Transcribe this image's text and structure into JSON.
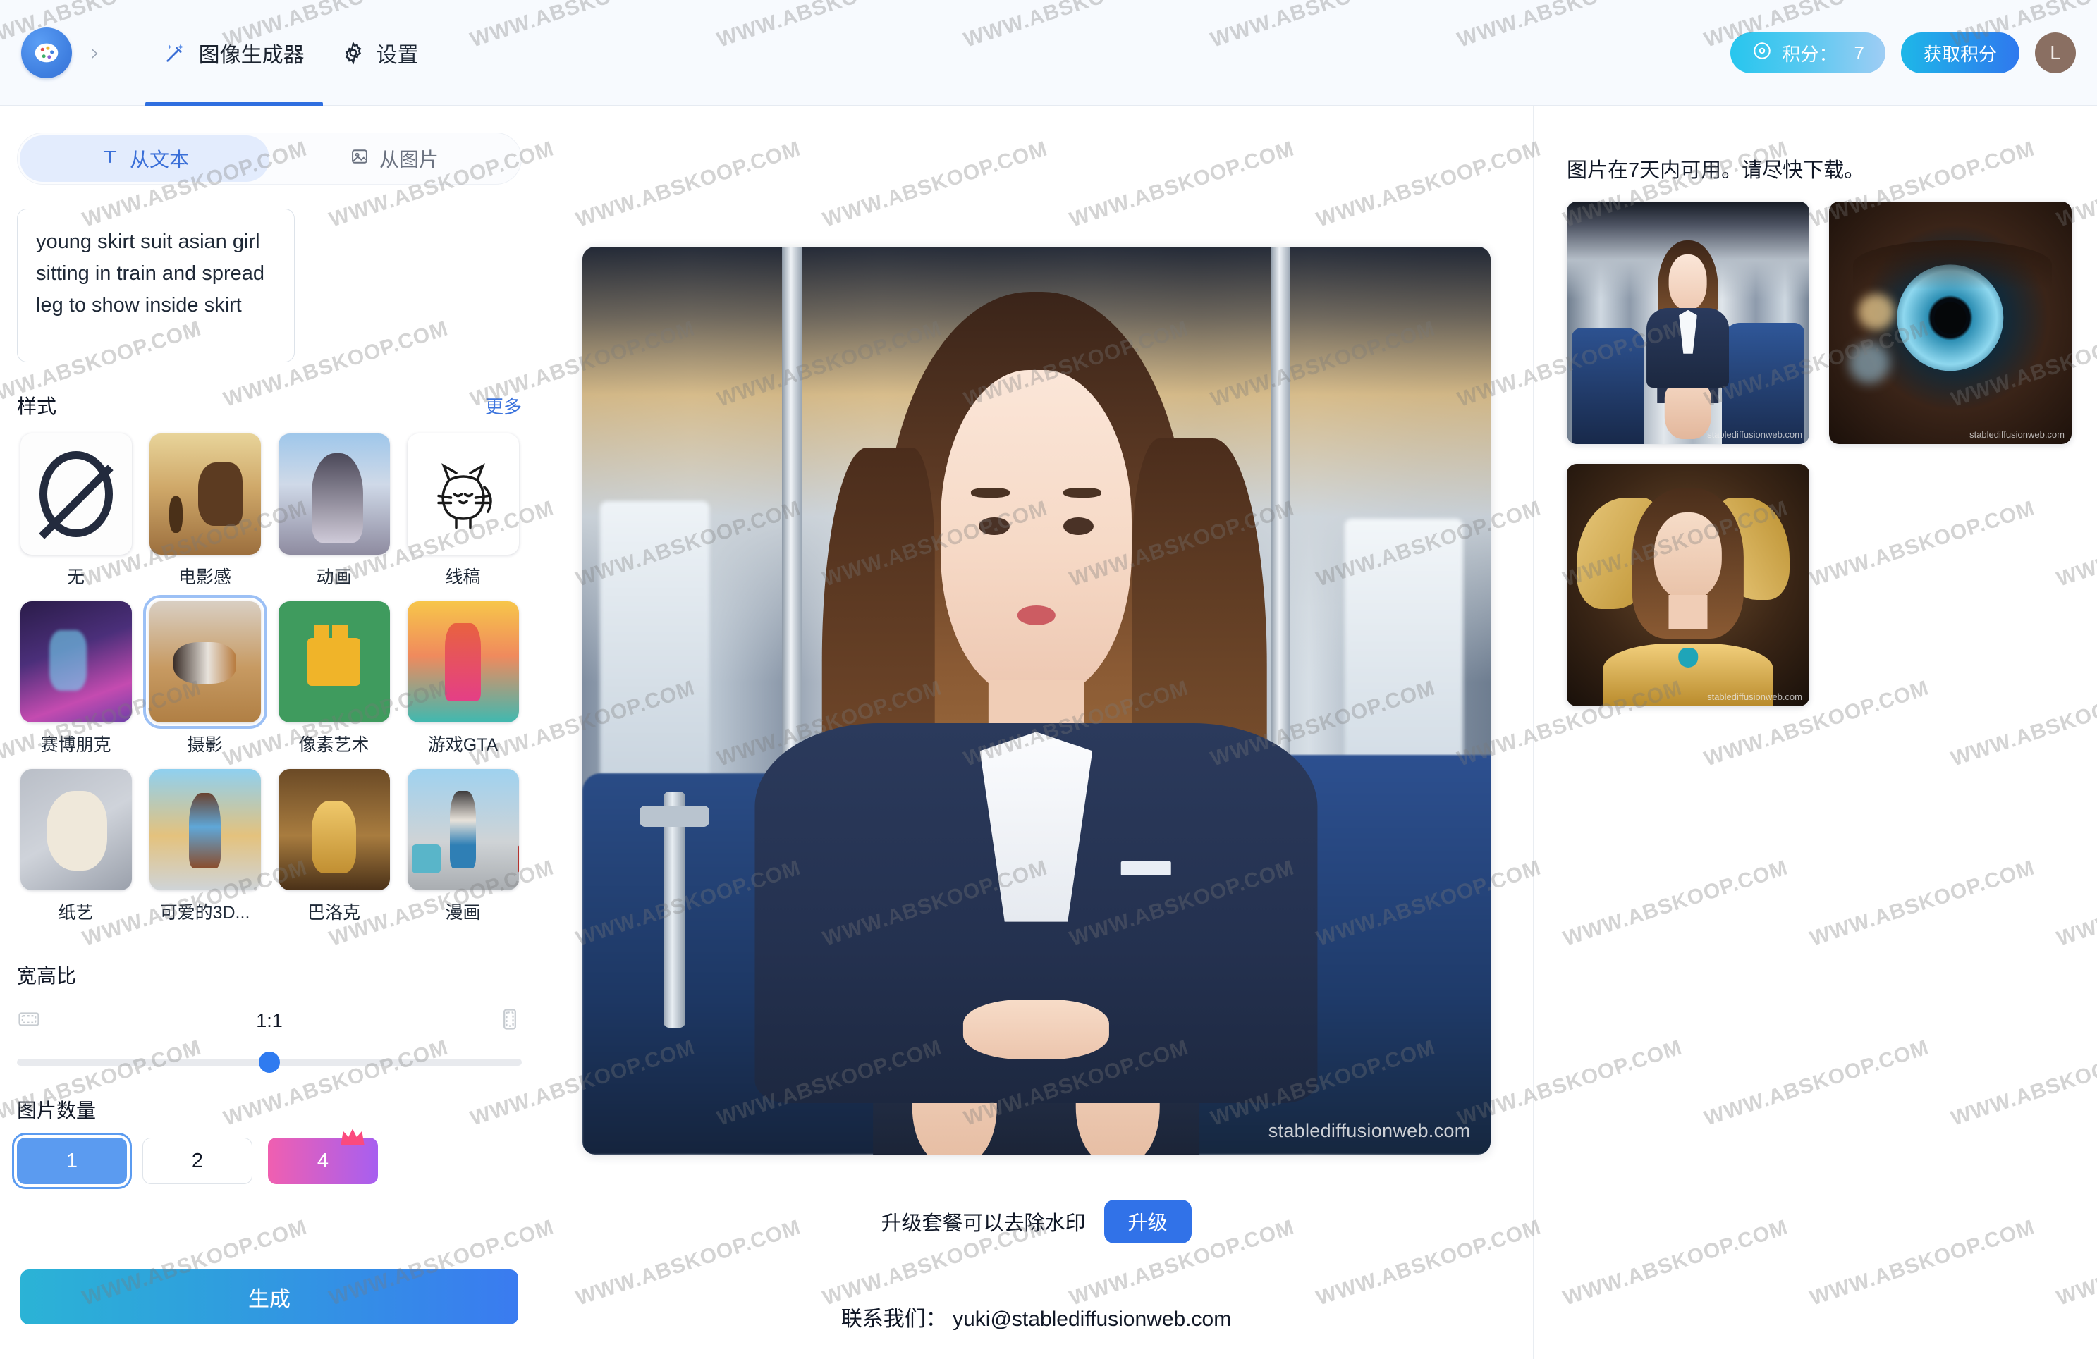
{
  "header": {
    "logo_icon": "palette-brain-logo",
    "chevron_icon": "chevron-right-icon",
    "nav": [
      {
        "label": "图像生成器",
        "icon": "magic-wand-icon",
        "active": true
      },
      {
        "label": "设置",
        "icon": "gear-icon",
        "active": false
      }
    ],
    "credits": {
      "icon": "credit-token-icon",
      "label": "积分：",
      "value": "7"
    },
    "get_credits_label": "获取积分",
    "avatar_initial": "L"
  },
  "left_panel": {
    "source_tabs": [
      {
        "label": "从文本",
        "icon": "text-t-icon",
        "active": true
      },
      {
        "label": "从图片",
        "icon": "image-icon",
        "active": false
      }
    ],
    "prompt": {
      "value": "young skirt suit asian girl sitting in train and spread leg to show inside skirt",
      "placeholder": "young skirt suit asian girl sitting in train and spread leg to show inside skirt"
    },
    "style_section": {
      "title": "样式",
      "more_label": "更多",
      "selected": "摄影",
      "items": [
        {
          "label": "无",
          "thumb": "t-none"
        },
        {
          "label": "电影感",
          "thumb": "t-cine"
        },
        {
          "label": "动画",
          "thumb": "t-anime"
        },
        {
          "label": "线稿",
          "thumb": "t-line"
        },
        {
          "label": "赛博朋克",
          "thumb": "t-cyber"
        },
        {
          "label": "摄影",
          "thumb": "t-photo"
        },
        {
          "label": "像素艺术",
          "thumb": "t-pixel"
        },
        {
          "label": "游戏GTA",
          "thumb": "t-gta"
        },
        {
          "label": "纸艺",
          "thumb": "t-paper"
        },
        {
          "label": "可爱的3D...",
          "thumb": "t-3d"
        },
        {
          "label": "巴洛克",
          "thumb": "t-baroque"
        },
        {
          "label": "漫画",
          "thumb": "t-manga"
        }
      ]
    },
    "ratio_section": {
      "title": "宽高比",
      "value": "1:1",
      "left_icon": "landscape-frame-icon",
      "right_icon": "portrait-frame-icon",
      "slider_percent": 50
    },
    "count_section": {
      "title": "图片数量",
      "options": [
        {
          "label": "1",
          "selected": true,
          "premium": false
        },
        {
          "label": "2",
          "selected": false,
          "premium": false
        },
        {
          "label": "4",
          "selected": false,
          "premium": true,
          "badge_icon": "crown-icon"
        }
      ]
    },
    "generate_label": "生成"
  },
  "center": {
    "image_watermark": "stablediffusionweb.com",
    "upgrade_text": "升级套餐可以去除水印",
    "upgrade_button": "升级",
    "contact_text": "联系我们： yuki@stablediffusionweb.com"
  },
  "right_panel": {
    "notice": "图片在7天内可用。请尽快下载。",
    "thumbnails": [
      {
        "alt": "asian-woman-suit-in-train",
        "watermark": "stablediffusionweb.com"
      },
      {
        "alt": "blue-eye-macro",
        "watermark": "stablediffusionweb.com"
      },
      {
        "alt": "gold-butterfly-woman",
        "watermark": "stablediffusionweb.com"
      }
    ]
  },
  "overlay_watermark": "WWW.ABSKOOP.COM",
  "colors": {
    "accent_blue": "#3172e8",
    "tab_underline": "#2f6fe0",
    "credits_pill": "#27c6ee",
    "premium_gradient_start": "#f05fb0",
    "premium_gradient_end": "#a75ff0",
    "generate_gradient_start": "#2bb3d6",
    "generate_gradient_end": "#3a7bf0"
  }
}
